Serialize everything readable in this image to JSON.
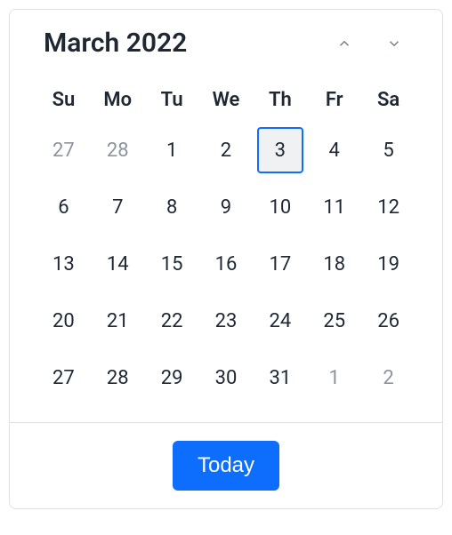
{
  "header": {
    "month_label": "March 2022"
  },
  "weekdays": [
    "Su",
    "Mo",
    "Tu",
    "We",
    "Th",
    "Fr",
    "Sa"
  ],
  "days": [
    {
      "value": "27",
      "other_month": true,
      "today": false
    },
    {
      "value": "28",
      "other_month": true,
      "today": false
    },
    {
      "value": "1",
      "other_month": false,
      "today": false
    },
    {
      "value": "2",
      "other_month": false,
      "today": false
    },
    {
      "value": "3",
      "other_month": false,
      "today": true
    },
    {
      "value": "4",
      "other_month": false,
      "today": false
    },
    {
      "value": "5",
      "other_month": false,
      "today": false
    },
    {
      "value": "6",
      "other_month": false,
      "today": false
    },
    {
      "value": "7",
      "other_month": false,
      "today": false
    },
    {
      "value": "8",
      "other_month": false,
      "today": false
    },
    {
      "value": "9",
      "other_month": false,
      "today": false
    },
    {
      "value": "10",
      "other_month": false,
      "today": false
    },
    {
      "value": "11",
      "other_month": false,
      "today": false
    },
    {
      "value": "12",
      "other_month": false,
      "today": false
    },
    {
      "value": "13",
      "other_month": false,
      "today": false
    },
    {
      "value": "14",
      "other_month": false,
      "today": false
    },
    {
      "value": "15",
      "other_month": false,
      "today": false
    },
    {
      "value": "16",
      "other_month": false,
      "today": false
    },
    {
      "value": "17",
      "other_month": false,
      "today": false
    },
    {
      "value": "18",
      "other_month": false,
      "today": false
    },
    {
      "value": "19",
      "other_month": false,
      "today": false
    },
    {
      "value": "20",
      "other_month": false,
      "today": false
    },
    {
      "value": "21",
      "other_month": false,
      "today": false
    },
    {
      "value": "22",
      "other_month": false,
      "today": false
    },
    {
      "value": "23",
      "other_month": false,
      "today": false
    },
    {
      "value": "24",
      "other_month": false,
      "today": false
    },
    {
      "value": "25",
      "other_month": false,
      "today": false
    },
    {
      "value": "26",
      "other_month": false,
      "today": false
    },
    {
      "value": "27",
      "other_month": false,
      "today": false
    },
    {
      "value": "28",
      "other_month": false,
      "today": false
    },
    {
      "value": "29",
      "other_month": false,
      "today": false
    },
    {
      "value": "30",
      "other_month": false,
      "today": false
    },
    {
      "value": "31",
      "other_month": false,
      "today": false
    },
    {
      "value": "1",
      "other_month": true,
      "today": false
    },
    {
      "value": "2",
      "other_month": true,
      "today": false
    }
  ],
  "footer": {
    "today_label": "Today"
  },
  "colors": {
    "primary": "#0d6efd",
    "text": "#1f2733",
    "muted": "#8e949c",
    "border": "#e0e0e0"
  }
}
